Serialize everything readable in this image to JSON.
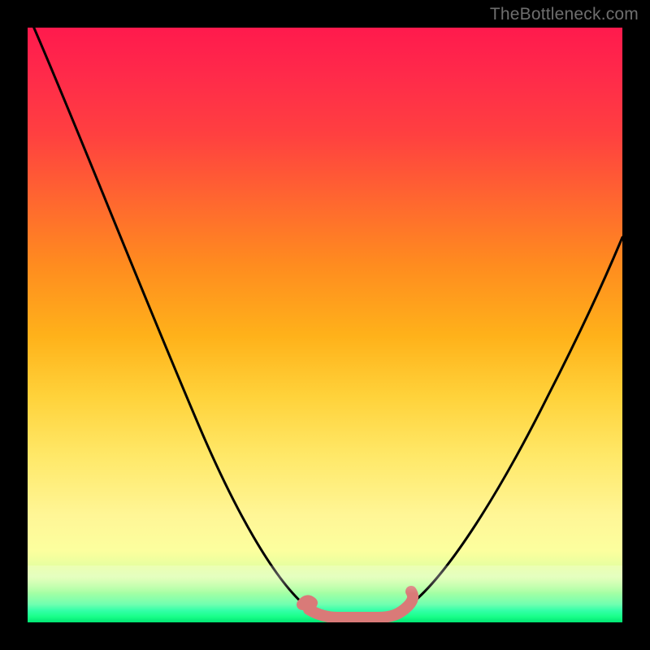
{
  "watermark": "TheBottleneck.com",
  "chart_data": {
    "type": "line",
    "title": "",
    "xlabel": "",
    "ylabel": "",
    "xlim": [
      0,
      100
    ],
    "ylim": [
      0,
      100
    ],
    "series": [
      {
        "name": "bottleneck-curve",
        "x": [
          0,
          6,
          12,
          18,
          24,
          30,
          36,
          41,
          44,
          46,
          48,
          50,
          52,
          54,
          56,
          58,
          62,
          68,
          74,
          80,
          88,
          96,
          100
        ],
        "values": [
          100,
          89,
          78,
          67,
          56,
          45,
          34,
          23,
          14,
          8,
          3,
          1,
          0,
          0,
          0,
          1,
          4,
          11,
          20,
          30,
          44,
          59,
          67
        ]
      },
      {
        "name": "optimal-zone-marker",
        "x": [
          48,
          50,
          52,
          54,
          56,
          58,
          60,
          62
        ],
        "values": [
          1.8,
          0.9,
          0.6,
          0.5,
          0.5,
          0.7,
          1.3,
          2.2
        ]
      }
    ],
    "background_gradient": {
      "top": "#ff1a4d",
      "mid": "#ffe868",
      "bottom": "#00e673"
    }
  }
}
